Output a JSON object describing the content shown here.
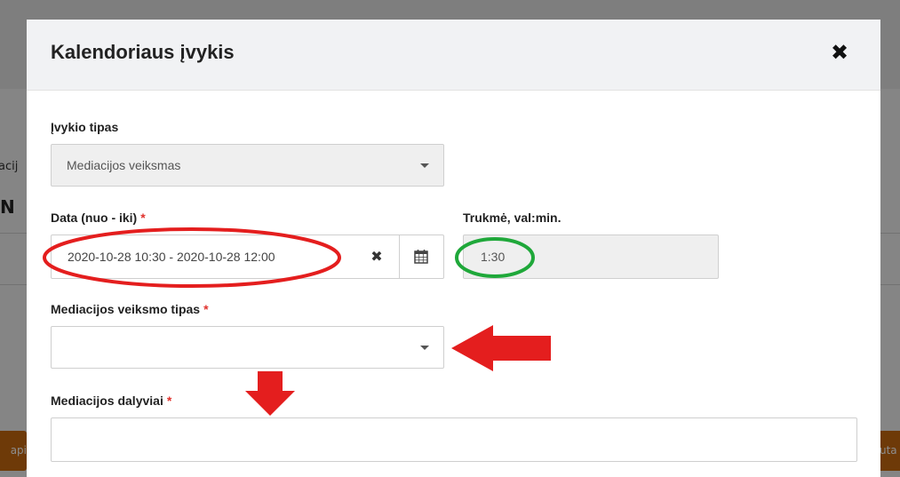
{
  "background": {
    "partial_text_1": "acij",
    "partial_text_2": "N",
    "partial_button_left": "api",
    "partial_button_right": "uta"
  },
  "modal": {
    "title": "Kalendoriaus įvykis",
    "close_symbol": "✖"
  },
  "event_type": {
    "label": "Įvykio tipas",
    "selected": "Mediacijos veiksmas"
  },
  "date_range": {
    "label": "Data (nuo - iki)",
    "required_mark": "*",
    "value": "2020-10-28 10:30 - 2020-10-28 12:00",
    "clear_symbol": "✖"
  },
  "duration": {
    "label": "Trukmė, val:min.",
    "value": "1:30"
  },
  "action_type": {
    "label": "Mediacijos veiksmo tipas",
    "required_mark": "*",
    "selected": ""
  },
  "participants": {
    "label": "Mediacijos dalyviai",
    "required_mark": "*",
    "value": ""
  },
  "annotation_colors": {
    "red": "#e41e1e",
    "green": "#1fa83a"
  }
}
